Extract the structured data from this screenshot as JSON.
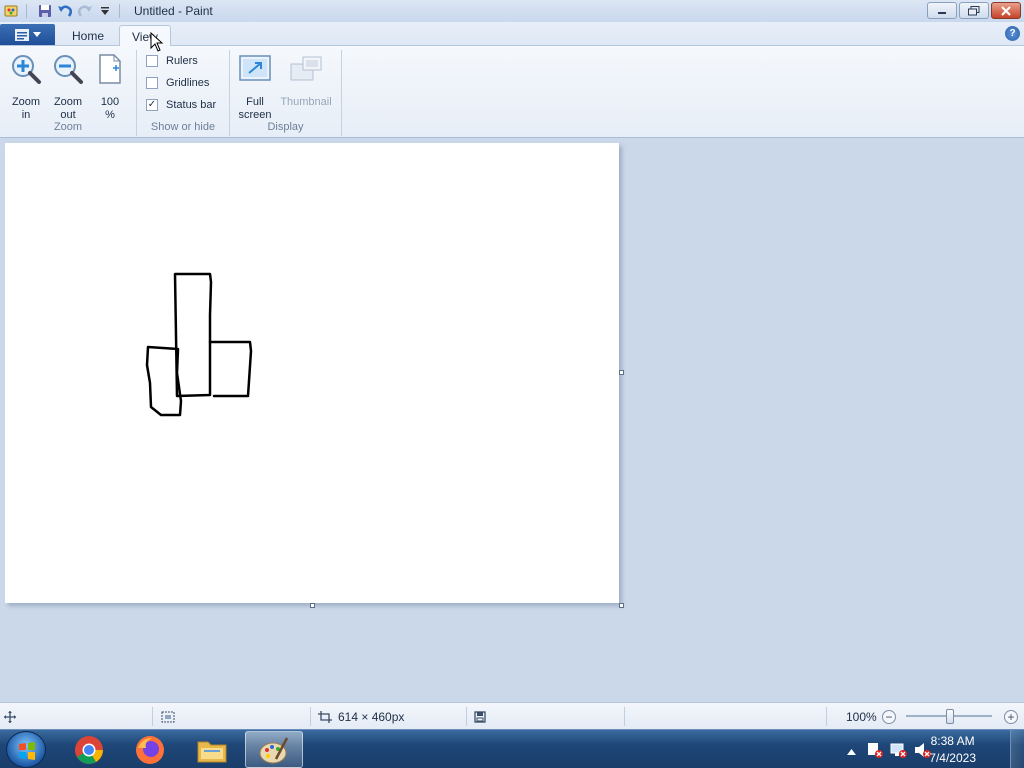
{
  "window": {
    "title": "Untitled - Paint"
  },
  "icons": {
    "app": "paint-app-icon",
    "save": "save-icon",
    "undo": "undo-icon",
    "redo": "redo-icon",
    "customize": "chevron-down-icon"
  },
  "tabs": {
    "file_icon": "file-menu-icon",
    "home": "Home",
    "view": "View"
  },
  "ribbon": {
    "zoom_group": {
      "label": "Zoom",
      "zoom_in": "Zoom in",
      "zoom_out": "Zoom out",
      "hundred": "100 %"
    },
    "show_hide_group": {
      "label": "Show or hide",
      "rulers": {
        "label": "Rulers",
        "checked": false
      },
      "gridlines": {
        "label": "Gridlines",
        "checked": false
      },
      "status_bar": {
        "label": "Status bar",
        "checked": true
      }
    },
    "display_group": {
      "label": "Display",
      "full_screen": "Full screen",
      "thumbnail": "Thumbnail"
    }
  },
  "statusbar": {
    "image_size": "614 × 460px",
    "zoom": "100%"
  },
  "taskbar": {
    "apps": [
      "Google Chrome",
      "Firefox",
      "File Explorer",
      "Paint"
    ],
    "time": "8:38 AM",
    "date": "7/4/2023"
  },
  "colors": {
    "accent": "#1f4f98",
    "ribbon_bg": "#f5f8fc",
    "workspace_bg": "#cbd8ea",
    "taskbar": "#1e4677"
  }
}
